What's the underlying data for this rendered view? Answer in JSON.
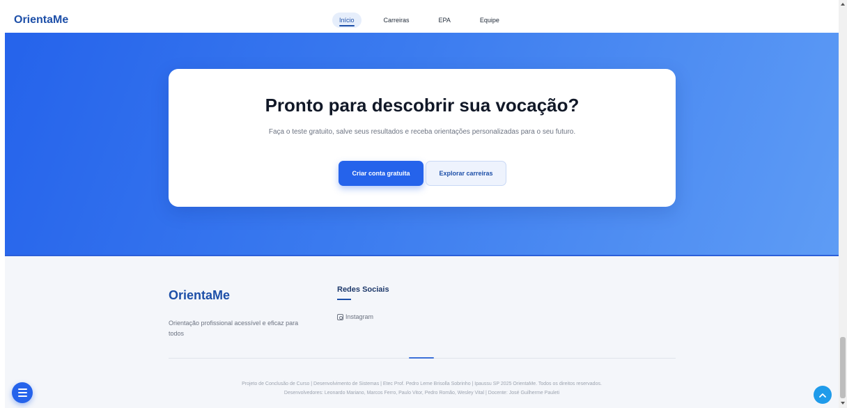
{
  "header": {
    "brand": "OrientaMe",
    "nav": [
      {
        "label": "Início",
        "active": true
      },
      {
        "label": "Carreiras",
        "active": false
      },
      {
        "label": "EPA",
        "active": false
      },
      {
        "label": "Equipe",
        "active": false
      }
    ]
  },
  "hero": {
    "title": "Pronto para descobrir sua vocação?",
    "subtitle": "Faça o teste gratuito, salve seus resultados e receba orientações personalizadas para o seu futuro.",
    "primary_button": "Criar conta gratuita",
    "secondary_button": "Explorar carreiras"
  },
  "footer": {
    "brand": "OrientaMe",
    "description": "Orientação profissional acessível e eficaz para todos",
    "social_title": "Redes Sociais",
    "instagram": "Instagram",
    "credits_line1": "Projeto de Conclusão de Curso | Desenvolvimento de Sistemas | Etec Prof. Pedro Leme Brisolla Sobrinho | Ipaussu SP 2025 OrientaMe. Todos os direitos reservados.",
    "credits_line2": "Desenvolvedores: Leonardo Mariano, Marcos Ferro, Paulo Vitor, Pedro Romão, Wesley Vital | Docente: José Guilherme Pauleti"
  },
  "icons": {
    "menu": "hamburger-menu-icon",
    "back_to_top": "chevron-up-icon",
    "instagram": "instagram-icon"
  },
  "colors": {
    "brand": "#1d4fa8",
    "primary": "#2563eb",
    "hero_gradient_start": "#2563eb",
    "hero_gradient_end": "#5e9cf5",
    "back_to_top": "#1f9bea"
  }
}
